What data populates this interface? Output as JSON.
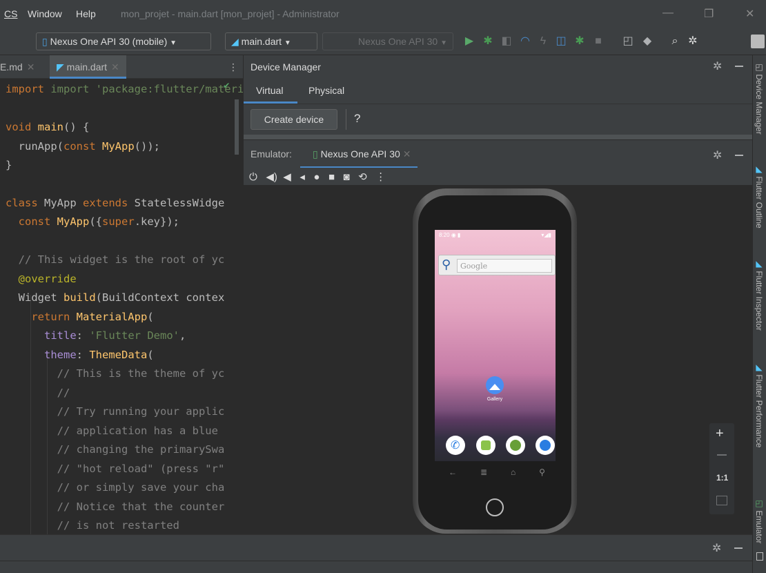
{
  "menu": {
    "cs": "CS",
    "window": "Window",
    "help": "Help"
  },
  "window_title": "mon_projet - main.dart [mon_projet] - Administrator",
  "toolbar": {
    "device_combo": "Nexus One API 30 (mobile)",
    "run_config": "main.dart",
    "running_device": "Nexus One API 30"
  },
  "editor": {
    "tabs": [
      {
        "label": "E.md"
      },
      {
        "label": "main.dart"
      }
    ],
    "lines": [
      "import 'package:flutter/materia",
      "",
      "void main() {",
      "  runApp(const MyApp());",
      "}",
      "",
      "class MyApp extends StatelessWidge",
      "  const MyApp({super.key});",
      "",
      "  // This widget is the root of yc",
      "  @override",
      "  Widget build(BuildContext contex",
      "    return MaterialApp(",
      "      title: 'Flutter Demo',",
      "      theme: ThemeData(",
      "        // This is the theme of yc",
      "        //",
      "        // Try running your applic",
      "        // application has a blue",
      "        // changing the primarySwa",
      "        // \"hot reload\" (press \"r\"",
      "        // or simply save your cha",
      "        // Notice that the counter",
      "        // is not restarted"
    ]
  },
  "device_manager": {
    "title": "Device Manager",
    "tabs": [
      "Virtual",
      "Physical"
    ],
    "create_button": "Create device",
    "help": "?"
  },
  "emulator": {
    "label": "Emulator:",
    "tab": "Nexus One API 30",
    "zoom_ratio": "1:1"
  },
  "phone": {
    "time": "8:20",
    "search_placeholder": "Google",
    "app_label": "Gallery"
  },
  "right_strip": [
    "Device Manager",
    "Flutter Outline",
    "Flutter Inspector",
    "Flutter Performance",
    "Emulator"
  ],
  "colors": {
    "accent_green": "#59a869",
    "bug_green": "#499c54",
    "ide_dark": "#2b2b2b",
    "ide_panel": "#3c3f41",
    "tab_underline": "#4a88c7"
  }
}
